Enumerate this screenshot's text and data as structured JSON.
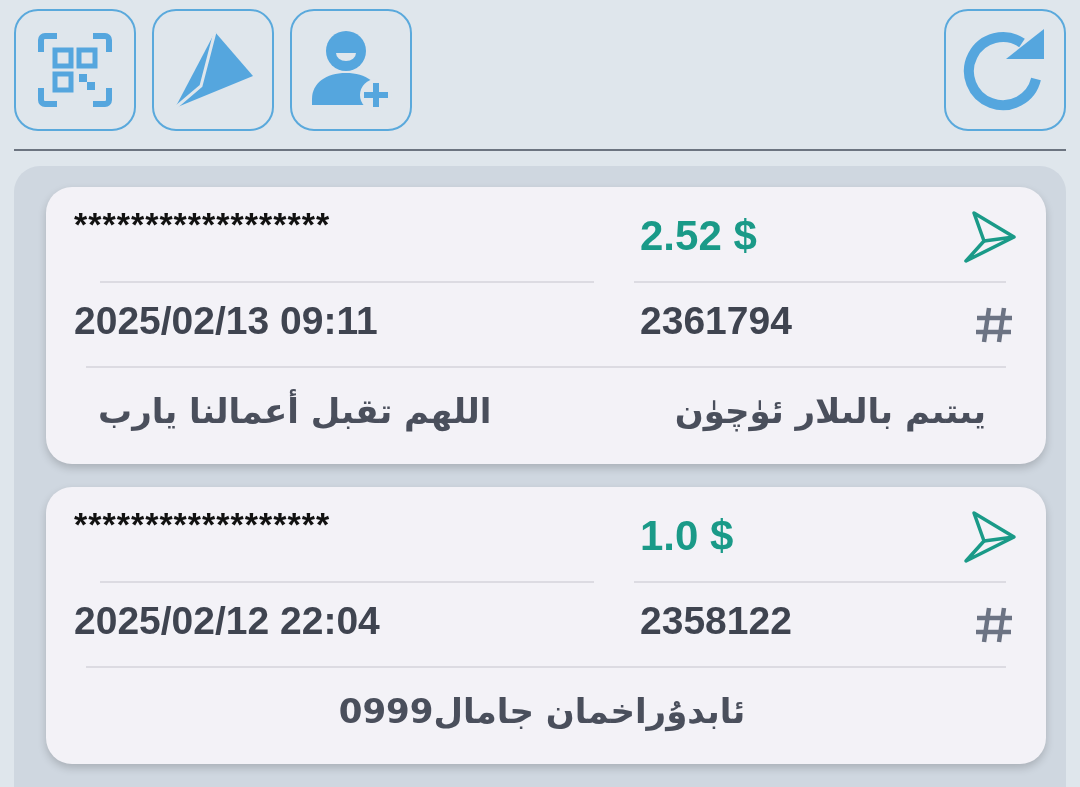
{
  "toolbar": {
    "buttons": [
      {
        "kind": "qr"
      },
      {
        "kind": "send"
      },
      {
        "kind": "add-user"
      }
    ],
    "refresh": {
      "kind": "refresh"
    }
  },
  "transfers": [
    {
      "masked": "******************",
      "amount": "2.52 $",
      "date": "2025/02/13 09:11",
      "id": "2361794",
      "notes": [
        "يىتىم بالىلار ئۈچۈن",
        "اللهم تقبل أعمالنا يارب"
      ]
    },
    {
      "masked": "******************",
      "amount": "1.0 $",
      "date": "2025/02/12 22:04",
      "id": "2358122",
      "notes": [
        "ئابدۇراخمان جامال0999"
      ]
    }
  ]
}
